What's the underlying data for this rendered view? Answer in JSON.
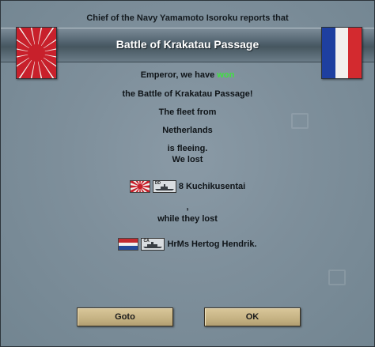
{
  "dialog": {
    "caption": "Chief of the Navy Yamamoto Isoroku reports that",
    "title": "Battle of Krakatau Passage",
    "message": {
      "line1_prefix": "Emperor, we have ",
      "line1_highlight": "won",
      "line2": "the Battle of Krakatau Passage!",
      "line3": "The fleet from",
      "line4": "Netherlands",
      "line5": "is fleeing.",
      "line6": "We lost",
      "own_loss": {
        "flag_icon": "japan-flag-icon",
        "ship_type": "DD",
        "label": "8 Kuchikusentai"
      },
      "separator": ",",
      "line7": "while they lost",
      "enemy_loss": {
        "flag_icon": "netherlands-flag-icon",
        "ship_type": "CA",
        "label": "HrMs Hertog Hendrik."
      }
    },
    "buttons": {
      "goto": "Goto",
      "ok": "OK"
    },
    "colors": {
      "won": "#3fe33f",
      "band": "#4e5f6b",
      "button": "#c5b283"
    },
    "flags": {
      "left": "japan-rising-sun-flag",
      "right": "france-flag"
    }
  }
}
